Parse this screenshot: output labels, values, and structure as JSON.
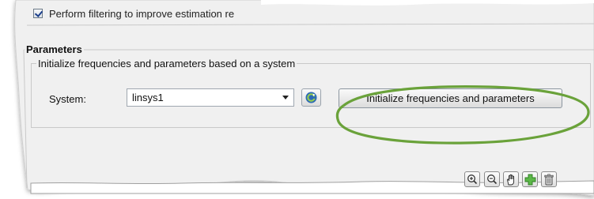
{
  "filtering": {
    "label": "Perform filtering to improve estimation re",
    "checked": true
  },
  "parameters": {
    "title": "Parameters",
    "group_label": "Initialize frequencies and parameters based on a system",
    "system_label": "System:",
    "system_value": "linsys1",
    "init_button_label": "Initialize frequencies and parameters"
  },
  "icons": {
    "refresh": "refresh-icon",
    "zoom_in": "zoom-in-icon",
    "zoom_out": "zoom-out-icon",
    "pan": "pan-hand-icon",
    "add": "add-plus-icon",
    "delete": "trash-icon"
  },
  "colors": {
    "highlight": "#6aa23a",
    "add_icon": "#5cb848",
    "panel_bg": "#f0f0f0"
  }
}
